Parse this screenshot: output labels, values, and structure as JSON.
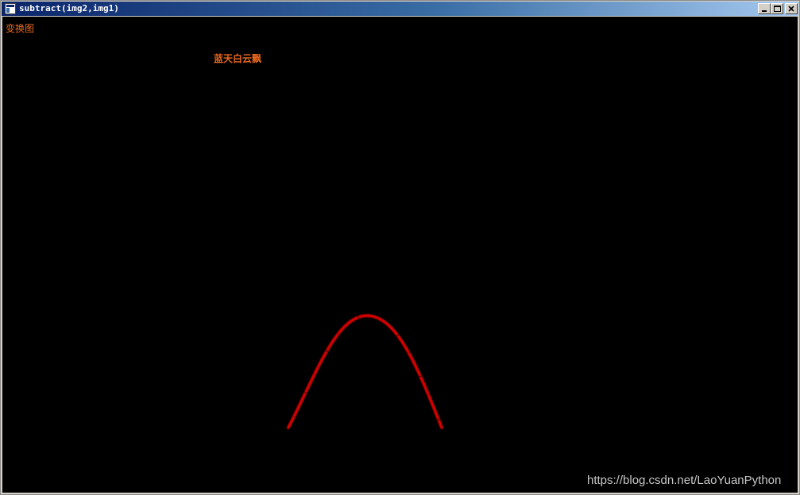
{
  "window": {
    "title": "subtract(img2,img1)",
    "icon": "app-window-icon",
    "controls": {
      "minimize_icon": "minimize-icon",
      "maximize_icon": "maximize-icon",
      "close_icon": "close-icon"
    }
  },
  "canvas": {
    "background": "#000000",
    "label_transform": "变换图",
    "label_sky": "蓝天白云飘",
    "label_color": "#e8681f",
    "arc_color": "#d40000"
  },
  "watermark": {
    "text": "https://blog.csdn.net/LaoYuanPython"
  }
}
